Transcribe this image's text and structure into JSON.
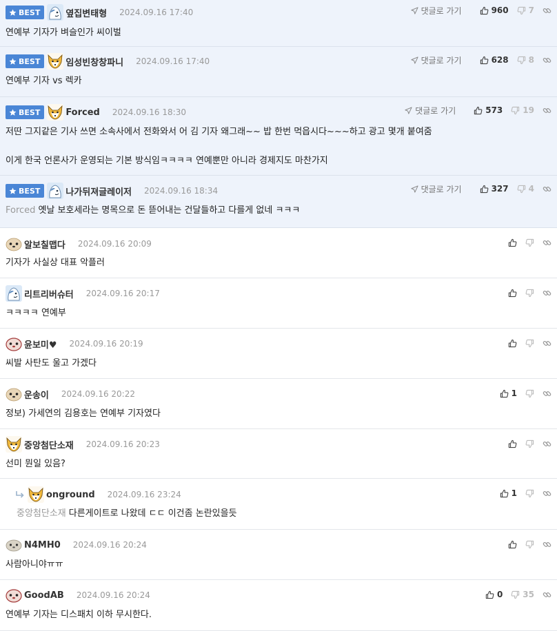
{
  "labels": {
    "best": "BEST",
    "go_comment": "댓글로 가기"
  },
  "colors": {
    "best_badge": "#4a86d6",
    "best_row_bg": "#eef3fb",
    "date_text": "#999999",
    "mention_text": "#999999"
  },
  "best_comments": [
    {
      "nick": "옆집변태형",
      "avatar": "mascot-blue",
      "date": "2024.09.16 17:40",
      "text": "연예부 기자가 벼슬인가 씨이벌",
      "up": "960",
      "down": "7"
    },
    {
      "nick": "임성빈창창파니",
      "avatar": "fox",
      "date": "2024.09.16 17:40",
      "text": "연예부 기자 vs 렉카",
      "up": "628",
      "down": "8"
    },
    {
      "nick": "Forced",
      "avatar": "fox",
      "date": "2024.09.16 18:30",
      "text": "저딴 그지같은 기사 쓰면 소속사에서 전화와서 어 김 기자 왜그래~~ 밥 한번 먹읍시다~~~하고 광고 몇개 붙여줌",
      "text2": "이게 한국 언론사가 운영되는 기본 방식임ㅋㅋㅋㅋ 연예뿐만 아니라 경제지도 마찬가지",
      "up": "573",
      "down": "19"
    },
    {
      "nick": "나가뒤져글레이저",
      "avatar": "mascot-blue",
      "date": "2024.09.16 18:34",
      "mention": "Forced",
      "text": "옛날 보호세라는 명목으로 돈 뜯어내는 건달들하고 다를게 없네 ㅋㅋㅋ",
      "up": "327",
      "down": "4"
    }
  ],
  "comments": [
    {
      "nick": "알보칠맵다",
      "avatar": "seal",
      "date": "2024.09.16 20:09",
      "text": "기자가 사실상 대표 악플러",
      "up": "",
      "down": ""
    },
    {
      "nick": "리트리버슈터",
      "avatar": "mascot-blue",
      "date": "2024.09.16 20:17",
      "text": "ㅋㅋㅋㅋ 연예부",
      "up": "",
      "down": ""
    },
    {
      "nick": "윤보미♥",
      "avatar": "seal-red",
      "date": "2024.09.16 20:19",
      "text": "씨발 사탄도 울고 가겠다",
      "up": "",
      "down": ""
    },
    {
      "nick": "운송이",
      "avatar": "seal",
      "date": "2024.09.16 20:22",
      "text": "정보) 가세연의 김용호는 연예부 기자였다",
      "up": "1",
      "down": ""
    },
    {
      "nick": "중앙첨단소재",
      "avatar": "fox",
      "date": "2024.09.16 20:23",
      "text": "선미 뭔일 있음?",
      "up": "",
      "down": ""
    },
    {
      "nick": "onground",
      "avatar": "fox",
      "date": "2024.09.16 23:24",
      "mention": "중앙첨단소재",
      "text": "다른게이트로 나왔데 ㄷㄷ 이건좀 논란있을듯",
      "up": "1",
      "down": "",
      "reply": true
    },
    {
      "nick": "N4MH0",
      "avatar": "seal-gray",
      "date": "2024.09.16 20:24",
      "text": "사람아니야ㅠㅠ",
      "up": "",
      "down": ""
    },
    {
      "nick": "GoodAB",
      "avatar": "seal-red",
      "date": "2024.09.16 20:24",
      "text": "연예부 기자는 디스패치 이하 무시한다.",
      "up": "0",
      "down": "35"
    }
  ]
}
